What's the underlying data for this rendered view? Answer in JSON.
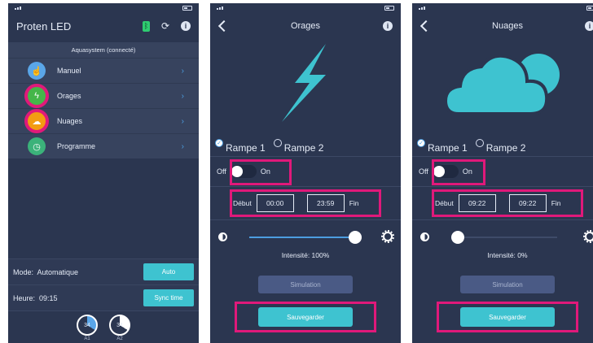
{
  "screen1": {
    "title": "Proten LED",
    "status": "Aquasystem (connecté)",
    "menu": [
      {
        "label": "Manuel",
        "icon": "hand-icon",
        "color": "#5aa6e8"
      },
      {
        "label": "Orages",
        "icon": "bolt-icon",
        "color": "#45b649"
      },
      {
        "label": "Nuages",
        "icon": "cloud-icon",
        "color": "#f39c12"
      },
      {
        "label": "Programme",
        "icon": "clock-icon",
        "color": "#3bb27a"
      }
    ],
    "mode_label": "Mode:",
    "mode_value": "Automatique",
    "mode_button": "Auto",
    "time_label": "Heure:",
    "time_value": "09:15",
    "sync_button": "Sync time",
    "gauges": [
      {
        "value": "34",
        "label": "A1",
        "fraction": 0.34
      },
      {
        "value": "34",
        "label": "A2",
        "fraction": 0.34
      }
    ]
  },
  "screen2": {
    "title": "Orages",
    "rampe1": "Rampe 1",
    "rampe2": "Rampe 2",
    "off": "Off",
    "on": "On",
    "start_label": "Début",
    "start": "00:00",
    "end": "23:59",
    "end_label": "Fin",
    "intensity": "Intensité: 100%",
    "intensity_fraction": 1.0,
    "simulation": "Simulation",
    "save": "Sauvegarder"
  },
  "screen3": {
    "title": "Nuages",
    "rampe1": "Rampe 1",
    "rampe2": "Rampe 2",
    "off": "Off",
    "on": "On",
    "start_label": "Début",
    "start": "09:22",
    "end": "09:22",
    "end_label": "Fin",
    "intensity": "Intensité: 0%",
    "intensity_fraction": 0.0,
    "simulation": "Simulation",
    "save": "Sauvegarder"
  },
  "colors": {
    "background": "#2b3650",
    "accent": "#3ec3d0",
    "highlight": "#e0197a"
  }
}
